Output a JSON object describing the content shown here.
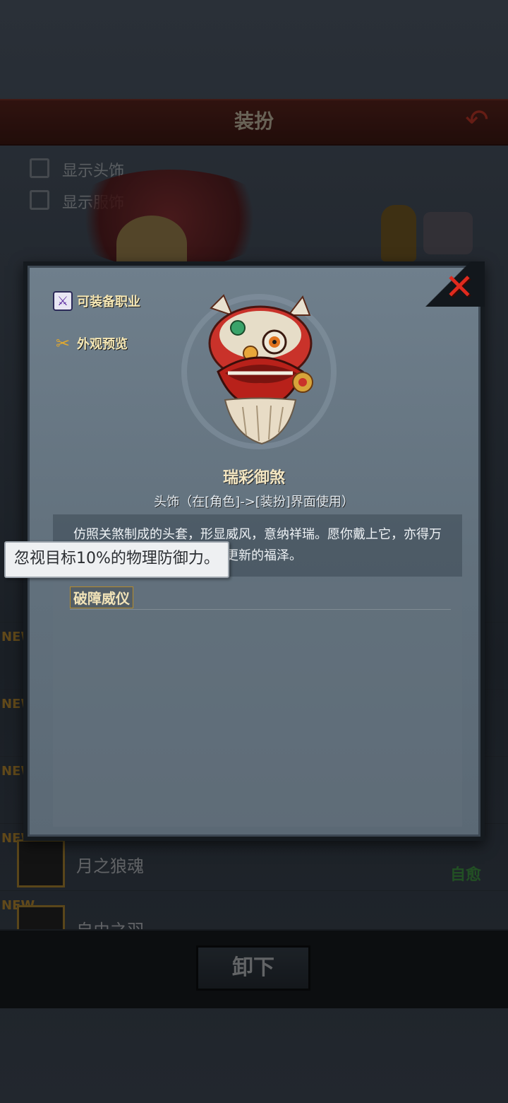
{
  "background": {
    "screen_title": "装扮",
    "options": [
      {
        "label": "显示头饰"
      },
      {
        "label": "显示服饰"
      }
    ],
    "list": [
      {
        "badge": "NEW",
        "name": "",
        "tag": ""
      },
      {
        "badge": "NEW",
        "name": "",
        "tag": ""
      },
      {
        "badge": "NEW",
        "name": "",
        "tag": ""
      },
      {
        "badge": "NEW",
        "name": "月之狼魂",
        "tag": "自愈"
      },
      {
        "badge": "NEW",
        "name": "自由之羽",
        "tag": ""
      }
    ],
    "unequip_label": "卸下"
  },
  "modal": {
    "close_glyph": "✕",
    "links": {
      "equip_job": "可装备职业",
      "preview": "外观预览"
    },
    "item": {
      "name": "瑞彩御煞",
      "type_line": "头饰（在[角色]->[装扮]界面使用）",
      "description": "仿照关煞制成的头套，形显威风，意纳祥瑞。愿你戴上它，亦得万象更新的福泽。",
      "skill_name": "破障威仪"
    },
    "tooltip": "忽视目标10%的物理防御力。"
  },
  "colors": {
    "accent_gold": "#f3e6c2",
    "close_red": "#e02a1e",
    "tag_green": "#4caf50"
  }
}
